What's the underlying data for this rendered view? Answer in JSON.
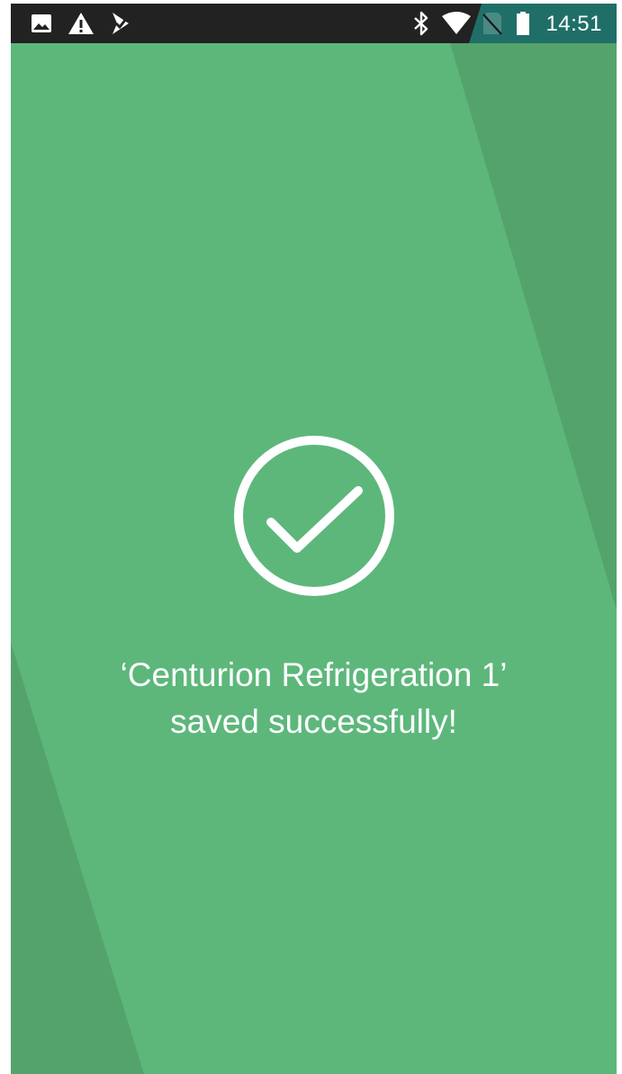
{
  "status_bar": {
    "time": "14:51",
    "left_icons": [
      "image-icon",
      "warning-icon",
      "check-flag-icon"
    ],
    "right_icons": [
      "bluetooth-icon",
      "wifi-icon",
      "no-sim-icon",
      "battery-icon"
    ]
  },
  "success": {
    "icon": "check-circle-icon",
    "line1": "‘Centurion Refrigeration 1’",
    "line2": "saved successfully!"
  },
  "colors": {
    "background": "#5db77b",
    "stripe": "#54a36c",
    "status_bar": "#222222",
    "status_accent": "#1f6f68",
    "text": "#ffffff"
  }
}
